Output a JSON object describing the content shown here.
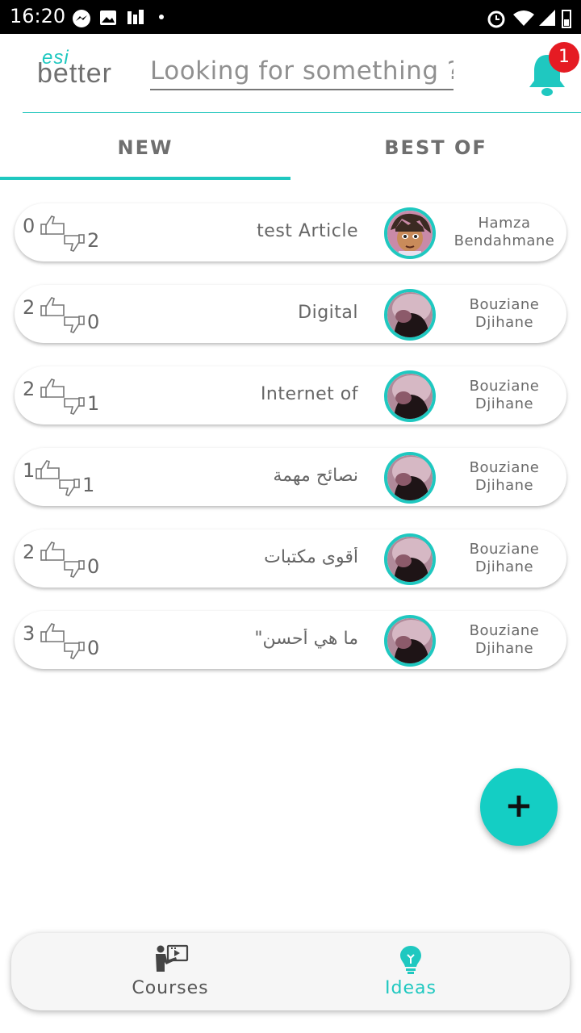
{
  "status_bar": {
    "time": "16:20"
  },
  "header": {
    "logo_top": "esi",
    "logo_bottom": "better",
    "search_placeholder": "Looking for something ?",
    "notification_count": "1"
  },
  "tabs": [
    {
      "label": "NEW",
      "active": true
    },
    {
      "label": "BEST OF",
      "active": false
    }
  ],
  "ideas": [
    {
      "likes": "0",
      "dislikes": "2",
      "title": "test Article",
      "author_first": "Hamza",
      "author_last": "Bendahmane",
      "avatar": "anime-avatar"
    },
    {
      "likes": "2",
      "dislikes": "0",
      "title": "Digital",
      "author_first": "Bouziane",
      "author_last": "Djihane",
      "avatar": "photo-avatar"
    },
    {
      "likes": "2",
      "dislikes": "1",
      "title": "Internet of",
      "author_first": "Bouziane",
      "author_last": "Djihane",
      "avatar": "photo-avatar"
    },
    {
      "likes": "1",
      "dislikes": "1",
      "title": "نصائح مهمة",
      "author_first": "Bouziane",
      "author_last": "Djihane",
      "avatar": "photo-avatar"
    },
    {
      "likes": "2",
      "dislikes": "0",
      "title": "أقوى مكتبات",
      "author_first": "Bouziane",
      "author_last": "Djihane",
      "avatar": "photo-avatar"
    },
    {
      "likes": "3",
      "dislikes": "0",
      "title": "\"ما هي أحسن",
      "author_first": "Bouziane",
      "author_last": "Djihane",
      "avatar": "photo-avatar"
    }
  ],
  "fab": {
    "label": "+"
  },
  "bottom_nav": [
    {
      "label": "Courses",
      "icon": "teacher-presentation-icon",
      "active": false
    },
    {
      "label": "Ideas",
      "icon": "lightbulb-icon",
      "active": true
    }
  ],
  "colors": {
    "accent": "#1fc8c0",
    "badge": "#e51b23",
    "text": "#666666"
  }
}
